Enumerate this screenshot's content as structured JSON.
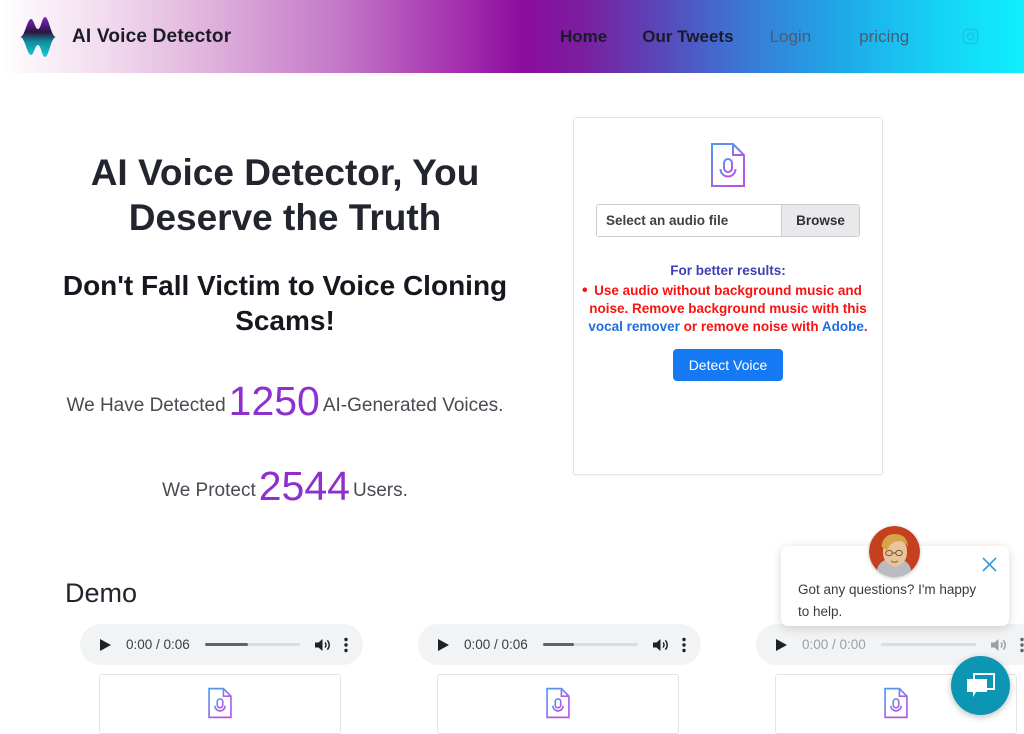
{
  "header": {
    "brand": "AI Voice Detector",
    "logo_icon": "waveform-logo-icon",
    "nav": [
      {
        "label": "Home",
        "style": "strong",
        "name": "nav-home"
      },
      {
        "label": "Our Tweets",
        "style": "strong",
        "name": "nav-ourtweets"
      },
      {
        "label": "Login",
        "style": "muted",
        "name": "nav-login"
      },
      {
        "label": "pricing",
        "style": "muted",
        "name": "nav-pricing"
      }
    ],
    "instagram_icon": "instagram-icon",
    "gradient": [
      "#ffffff",
      "#e0b4dd",
      "#8b0c9e",
      "#3d74d4",
      "#0ff0ff"
    ]
  },
  "hero": {
    "title": "AI Voice Detector, You Deserve the Truth",
    "subtitle": "Don't Fall Victim to Voice Cloning Scams!",
    "stats": {
      "detected_prefix": "We Have Detected",
      "detected_count": "1250",
      "detected_suffix": "AI-Generated Voices.",
      "protected_prefix": "We Protect",
      "protected_count": "2544",
      "protected_suffix": "Users.",
      "number_color": "#8e2fce"
    }
  },
  "upload": {
    "file_icon": "audio-file-icon",
    "input_value": "Select an audio file",
    "browse_label": "Browse",
    "tips_heading": "For better results:",
    "tip_line_1": "Use audio without background music and noise.",
    "tip_line_2_a": "Remove background music with this ",
    "tip_link_1": "vocal remover",
    "tip_line_2_b": " or remove noise with ",
    "tip_link_2": "Adobe",
    "tip_line_2_c": ".",
    "detect_label": "Detect Voice",
    "detect_color": "#1479f2",
    "tip_color": "#fb1111",
    "link_color": "#1f6fe0"
  },
  "demo": {
    "heading": "Demo",
    "players": [
      {
        "time": "0:00 / 0:06",
        "progress": 45,
        "disabled": false,
        "name": "audio-player-1"
      },
      {
        "time": "0:00 / 0:06",
        "progress": 33,
        "disabled": false,
        "name": "audio-player-2"
      },
      {
        "time": "0:00 / 0:00",
        "progress": 0,
        "disabled": true,
        "name": "audio-player-3"
      }
    ],
    "file_cards": [
      {
        "icon": "audio-file-icon",
        "name": "demo-file-card-1"
      },
      {
        "icon": "audio-file-icon",
        "name": "demo-file-card-2"
      },
      {
        "icon": "audio-file-icon",
        "name": "demo-file-card-3"
      }
    ]
  },
  "chat": {
    "message": "Got any questions? I'm happy to help.",
    "avatar_icon": "agent-avatar",
    "close_icon": "close-icon",
    "launcher_icon": "chat-bubble-icon",
    "launcher_color": "#0d96b3"
  }
}
